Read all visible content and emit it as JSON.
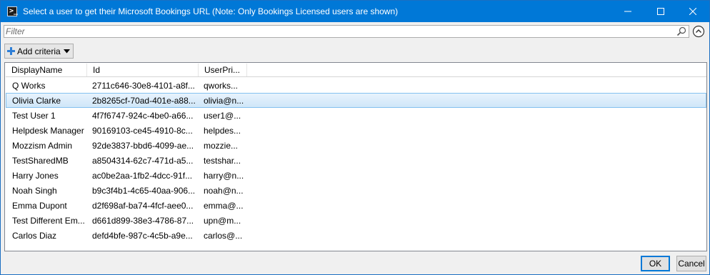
{
  "window": {
    "title": "Select a user to get their Microsoft Bookings URL (Note: Only Bookings Licensed users are shown)",
    "app_icon": "powershell-icon",
    "controls": [
      "minimize-icon",
      "maximize-icon",
      "close-icon"
    ]
  },
  "filter": {
    "placeholder": "Filter",
    "value": ""
  },
  "toolbar": {
    "add_criteria_label": "Add criteria"
  },
  "table": {
    "columns": [
      "DisplayName",
      "Id",
      "UserPri..."
    ],
    "selected_index": 1,
    "rows": [
      {
        "display_name": "Q Works",
        "id": "2711c646-30e8-4101-a8f...",
        "upn": "qworks..."
      },
      {
        "display_name": "Olivia Clarke",
        "id": "2b8265cf-70ad-401e-a88...",
        "upn": "olivia@n..."
      },
      {
        "display_name": "Test User 1",
        "id": "4f7f6747-924c-4be0-a66...",
        "upn": "user1@..."
      },
      {
        "display_name": "Helpdesk Manager",
        "id": "90169103-ce45-4910-8c...",
        "upn": "helpdes..."
      },
      {
        "display_name": "Mozzism Admin",
        "id": "92de3837-bbd6-4099-ae...",
        "upn": "mozzie..."
      },
      {
        "display_name": "TestSharedMB",
        "id": "a8504314-62c7-471d-a5...",
        "upn": "testshar..."
      },
      {
        "display_name": "Harry Jones",
        "id": "ac0be2aa-1fb2-4dcc-91f...",
        "upn": "harry@n..."
      },
      {
        "display_name": "Noah Singh",
        "id": "b9c3f4b1-4c65-40aa-906...",
        "upn": "noah@n..."
      },
      {
        "display_name": "Emma Dupont",
        "id": "d2f698af-ba74-4fcf-aee0...",
        "upn": "emma@..."
      },
      {
        "display_name": "Test Different Em...",
        "id": "d661d899-38e3-4786-87...",
        "upn": "upn@m..."
      },
      {
        "display_name": "Carlos Diaz",
        "id": "defd4bfe-987c-4c5b-a9e...",
        "upn": "carlos@..."
      }
    ]
  },
  "buttons": {
    "ok_label": "OK",
    "cancel_label": "Cancel"
  },
  "colors": {
    "titlebar": "#0078d7",
    "selection": "#cfe6f8",
    "selection_border": "#84c1ef",
    "plus_icon": "#2f7fd6"
  }
}
